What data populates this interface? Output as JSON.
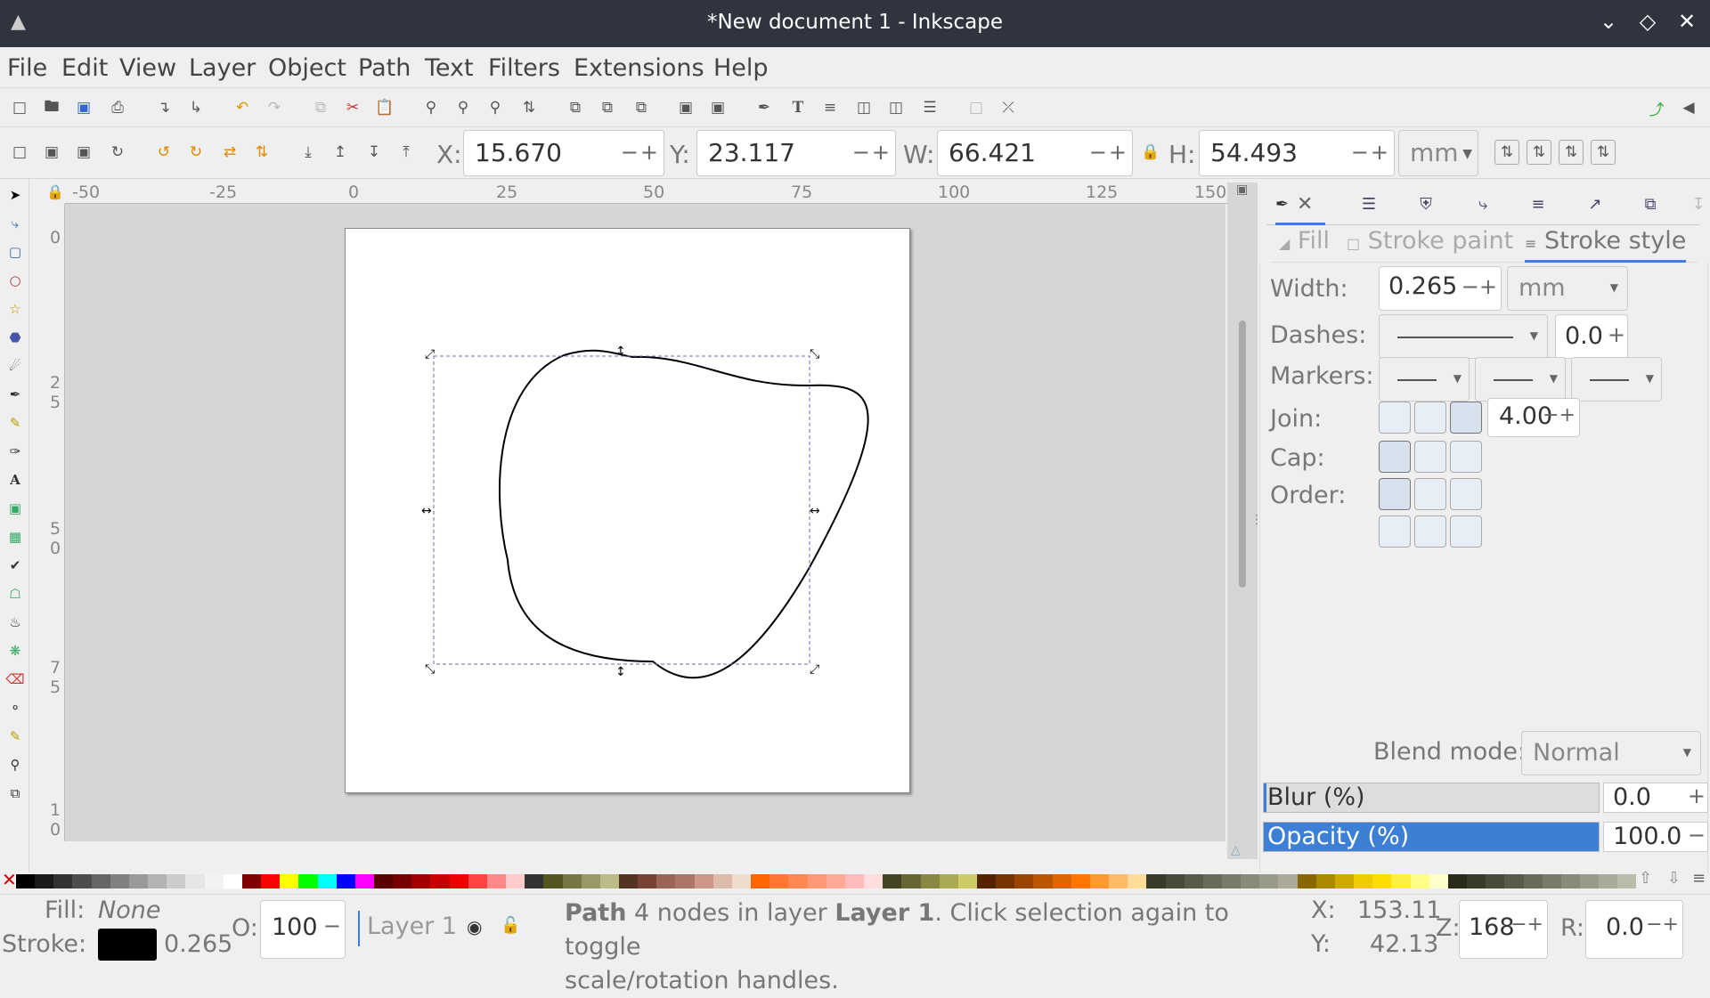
{
  "window": {
    "title": "*New document 1 - Inkscape"
  },
  "menu": [
    "File",
    "Edit",
    "View",
    "Layer",
    "Object",
    "Path",
    "Text",
    "Filters",
    "Extensions",
    "Help"
  ],
  "controls": {
    "x_label": "X:",
    "x_value": "15.670",
    "y_label": "Y:",
    "y_value": "23.117",
    "w_label": "W:",
    "w_value": "66.421",
    "h_label": "H:",
    "h_value": "54.493",
    "unit": "mm"
  },
  "ruler": {
    "h_ticks": [
      "-50",
      "-25",
      "0",
      "25",
      "50",
      "75",
      "100",
      "125",
      "150"
    ],
    "v_ticks": [
      "0",
      "2\n5",
      "5\n0",
      "7\n5",
      "1\n0"
    ]
  },
  "fill_stroke": {
    "tabs": [
      "Fill",
      "Stroke paint",
      "Stroke style"
    ],
    "active_tab": "Stroke style",
    "width_label": "Width:",
    "width_value": "0.265",
    "width_unit": "mm",
    "dashes_label": "Dashes:",
    "dashes_offset": "0.0",
    "markers_label": "Markers:",
    "join_label": "Join:",
    "miter_value": "4.00",
    "cap_label": "Cap:",
    "order_label": "Order:",
    "blend_label": "Blend mode:",
    "blend_value": "Normal",
    "blur_label": "Blur (%)",
    "blur_value": "0.0",
    "opacity_label": "Opacity (%)",
    "opacity_value": "100.0",
    "opacity_fraction": 1.0
  },
  "status": {
    "fill_label": "Fill:",
    "fill_value": "None",
    "stroke_label": "Stroke:",
    "stroke_width": "0.265",
    "stroke_color": "#000000",
    "o_label": "O:",
    "o_value": "100",
    "layer": "Layer 1",
    "msg_obj": "Path",
    "msg_mid": " 4 nodes in layer ",
    "msg_layer": "Layer 1",
    "msg_end": ". Click selection again to toggle",
    "msg_line2": "scale/rotation handles.",
    "x_label": "X:",
    "x_value": "153.11",
    "y_label": "Y:",
    "y_value": "42.13",
    "z_label": "Z:",
    "z_value": "168",
    "r_label": "R:",
    "r_value": "0.0"
  },
  "colors": {
    "accent": "#3d7fd4",
    "titlebar": "#2f343f"
  }
}
